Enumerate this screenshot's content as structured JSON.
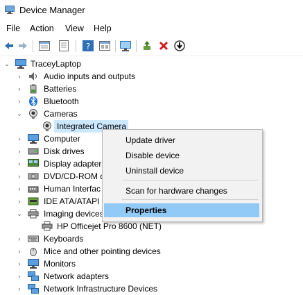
{
  "window": {
    "title": "Device Manager"
  },
  "menu": [
    "File",
    "Action",
    "View",
    "Help"
  ],
  "toolbar": {
    "buttons": [
      "back-arrow-icon",
      "forward-arrow-icon",
      "properties-icon",
      "refresh-icon",
      "help-icon",
      "view-icon",
      "monitor-icon",
      "update-driver-icon",
      "uninstall-icon",
      "download-icon"
    ]
  },
  "tree": {
    "root": "TraceyLaptop",
    "items": [
      {
        "label": "Audio inputs and outputs"
      },
      {
        "label": "Batteries"
      },
      {
        "label": "Bluetooth"
      },
      {
        "label": "Cameras"
      },
      {
        "label": "Integrated Camera"
      },
      {
        "label": "Computer"
      },
      {
        "label": "Disk drives"
      },
      {
        "label": "Display adapters"
      },
      {
        "label": "DVD/CD-ROM d"
      },
      {
        "label": "Human Interfac"
      },
      {
        "label": "IDE ATA/ATAPI c"
      },
      {
        "label": "Imaging devices"
      },
      {
        "label": "HP Officejet Pro 8600 (NET)"
      },
      {
        "label": "Keyboards"
      },
      {
        "label": "Mice and other pointing devices"
      },
      {
        "label": "Monitors"
      },
      {
        "label": "Network adapters"
      },
      {
        "label": "Network Infrastructure Devices"
      }
    ]
  },
  "context_menu": {
    "items": [
      "Update driver",
      "Disable device",
      "Uninstall device",
      "Scan for hardware changes",
      "Properties"
    ]
  },
  "colors": {
    "selection": "#cce8ff",
    "menu_highlight": "#91c9f7"
  }
}
